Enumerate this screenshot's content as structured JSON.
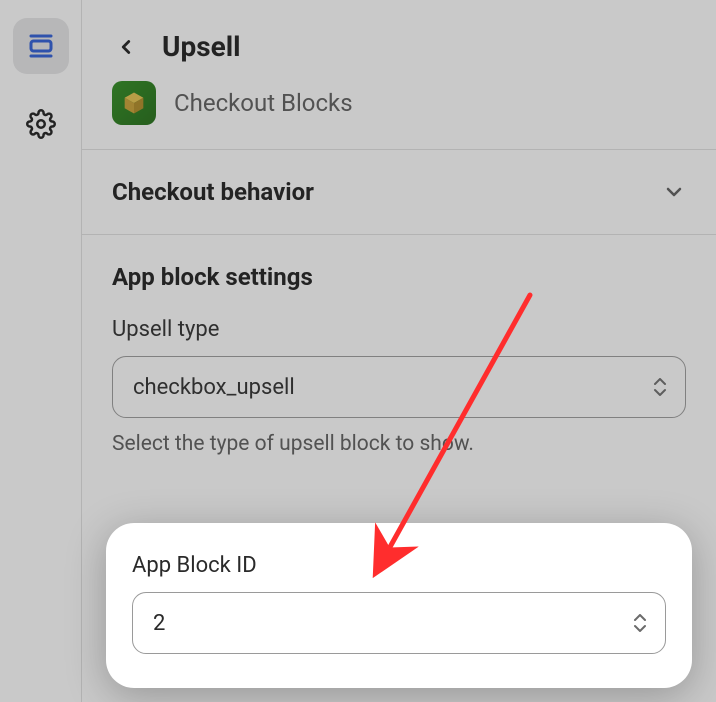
{
  "rail": {
    "active_item": "section",
    "items": [
      "section",
      "settings"
    ]
  },
  "header": {
    "title": "Upsell",
    "app_name": "Checkout Blocks"
  },
  "collapsible": {
    "title": "Checkout behavior"
  },
  "settings": {
    "title": "App block settings",
    "upsell_type": {
      "label": "Upsell type",
      "value": "checkbox_upsell",
      "help": "Select the type of upsell block to show."
    },
    "app_block_id": {
      "label": "App Block ID",
      "value": "2"
    }
  },
  "annotation": {
    "arrow_color": "#ff2d2d"
  }
}
